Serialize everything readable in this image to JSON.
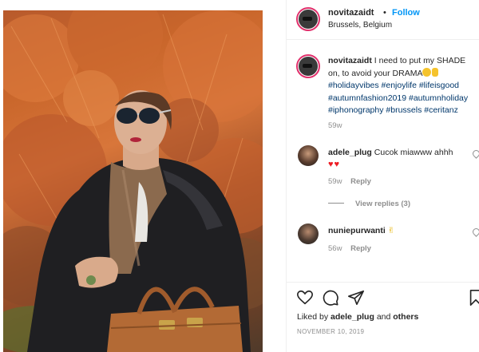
{
  "post": {
    "username": "novitazaidt",
    "separator": "•",
    "follow_label": "Follow",
    "location": "Brussels, Belgium"
  },
  "caption": {
    "username": "novitazaidt",
    "text": "I need to put my SHADE on, to avoid your DRAMA",
    "hashtags": "#holidayvibes #enjoylife #lifeisgood #autumnfashion2019 #autumnholiday #iphonography #brussels #ceritanz",
    "time": "59w"
  },
  "comments": [
    {
      "username": "adele_plug",
      "text": "Cucok miawww ahhh",
      "hearts": "♥♥",
      "time": "59w",
      "reply_label": "Reply",
      "view_replies": "View replies (3)"
    },
    {
      "username": "nuniepurwanti",
      "text": "✌",
      "time": "56w",
      "reply_label": "Reply"
    }
  ],
  "actions": {
    "icons": [
      "heart-icon",
      "comment-icon",
      "share-icon",
      "bookmark-icon"
    ]
  },
  "likes": {
    "prefix": "Liked by",
    "user": "adele_plug",
    "conjunction": "and",
    "others": "others"
  },
  "date": "NOVEMBER 10, 2019",
  "colors": {
    "follow": "#0095f6",
    "hashtag": "#00376b",
    "muted": "#8e8e8e",
    "heart_red": "#ed1c24"
  }
}
